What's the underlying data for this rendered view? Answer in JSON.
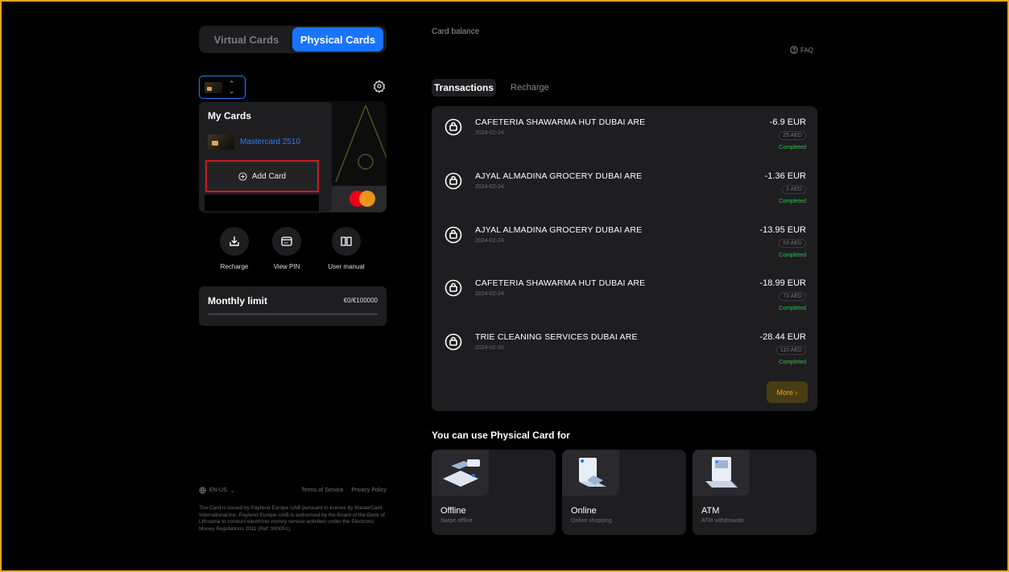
{
  "tabs": {
    "virtual": "Virtual Cards",
    "physical": "Physical Cards"
  },
  "dropdown": {
    "title": "My Cards",
    "card_label": "Mastercard 2510",
    "add_card": "Add Card"
  },
  "actions": [
    {
      "label": "Recharge",
      "icon": "recharge-icon"
    },
    {
      "label": "View PIN",
      "icon": "pin-icon"
    },
    {
      "label": "User manual",
      "icon": "book-icon"
    }
  ],
  "limit": {
    "title": "Monthly limit",
    "value": "€0/€100000",
    "progress": 0
  },
  "footer": {
    "lang": "EN-US",
    "terms": "Terms of Service",
    "privacy": "Privacy Policy",
    "legal": "The Card is issued by Paytend Europe UAB pursuant to licence by MasterCard International Inc. Paytend Europe UAB is authorised by the Board of the Bank of Lithuania to conduct electronic money service activities under the Electronic Money Regulations 2011 (Ref: 900051)."
  },
  "balance": {
    "label": "Card balance"
  },
  "faq": "FAQ",
  "tx_tabs": {
    "active": "Transactions",
    "other": "Recharge"
  },
  "transactions": [
    {
      "merchant": "CAFETERIA SHAWARMA HUT DUBAI ARE",
      "date": "2024-02-24",
      "amount": "-6.9 EUR",
      "local": "25 AED",
      "status": "Completed"
    },
    {
      "merchant": "AJYAL ALMADINA GROCERY DUBAI ARE",
      "date": "2024-02-24",
      "amount": "-1.36 EUR",
      "local": "3 AED",
      "status": "Completed"
    },
    {
      "merchant": "AJYAL ALMADINA GROCERY DUBAI ARE",
      "date": "2024-02-24",
      "amount": "-13.95 EUR",
      "local": "53 AED",
      "status": "Completed"
    },
    {
      "merchant": "CAFETERIA SHAWARMA HUT DUBAI ARE",
      "date": "2024-02-24",
      "amount": "-18.99 EUR",
      "local": "73 AED",
      "status": "Completed"
    },
    {
      "merchant": "TRIE CLEANING SERVICES DUBAI ARE",
      "date": "2024-02-20",
      "amount": "-28.44 EUR",
      "local": "110 AED",
      "status": "Completed"
    }
  ],
  "more": "More ›",
  "use_title": "You can use Physical Card for",
  "uses": [
    {
      "name": "Offline",
      "desc": "Swipe offline"
    },
    {
      "name": "Online",
      "desc": "Online shopping"
    },
    {
      "name": "ATM",
      "desc": "ATM withdrawals"
    }
  ],
  "colors": {
    "accent": "#1a73ff",
    "frame": "#e3a722",
    "success": "#2ec14a",
    "highlight": "#c81e1e"
  }
}
